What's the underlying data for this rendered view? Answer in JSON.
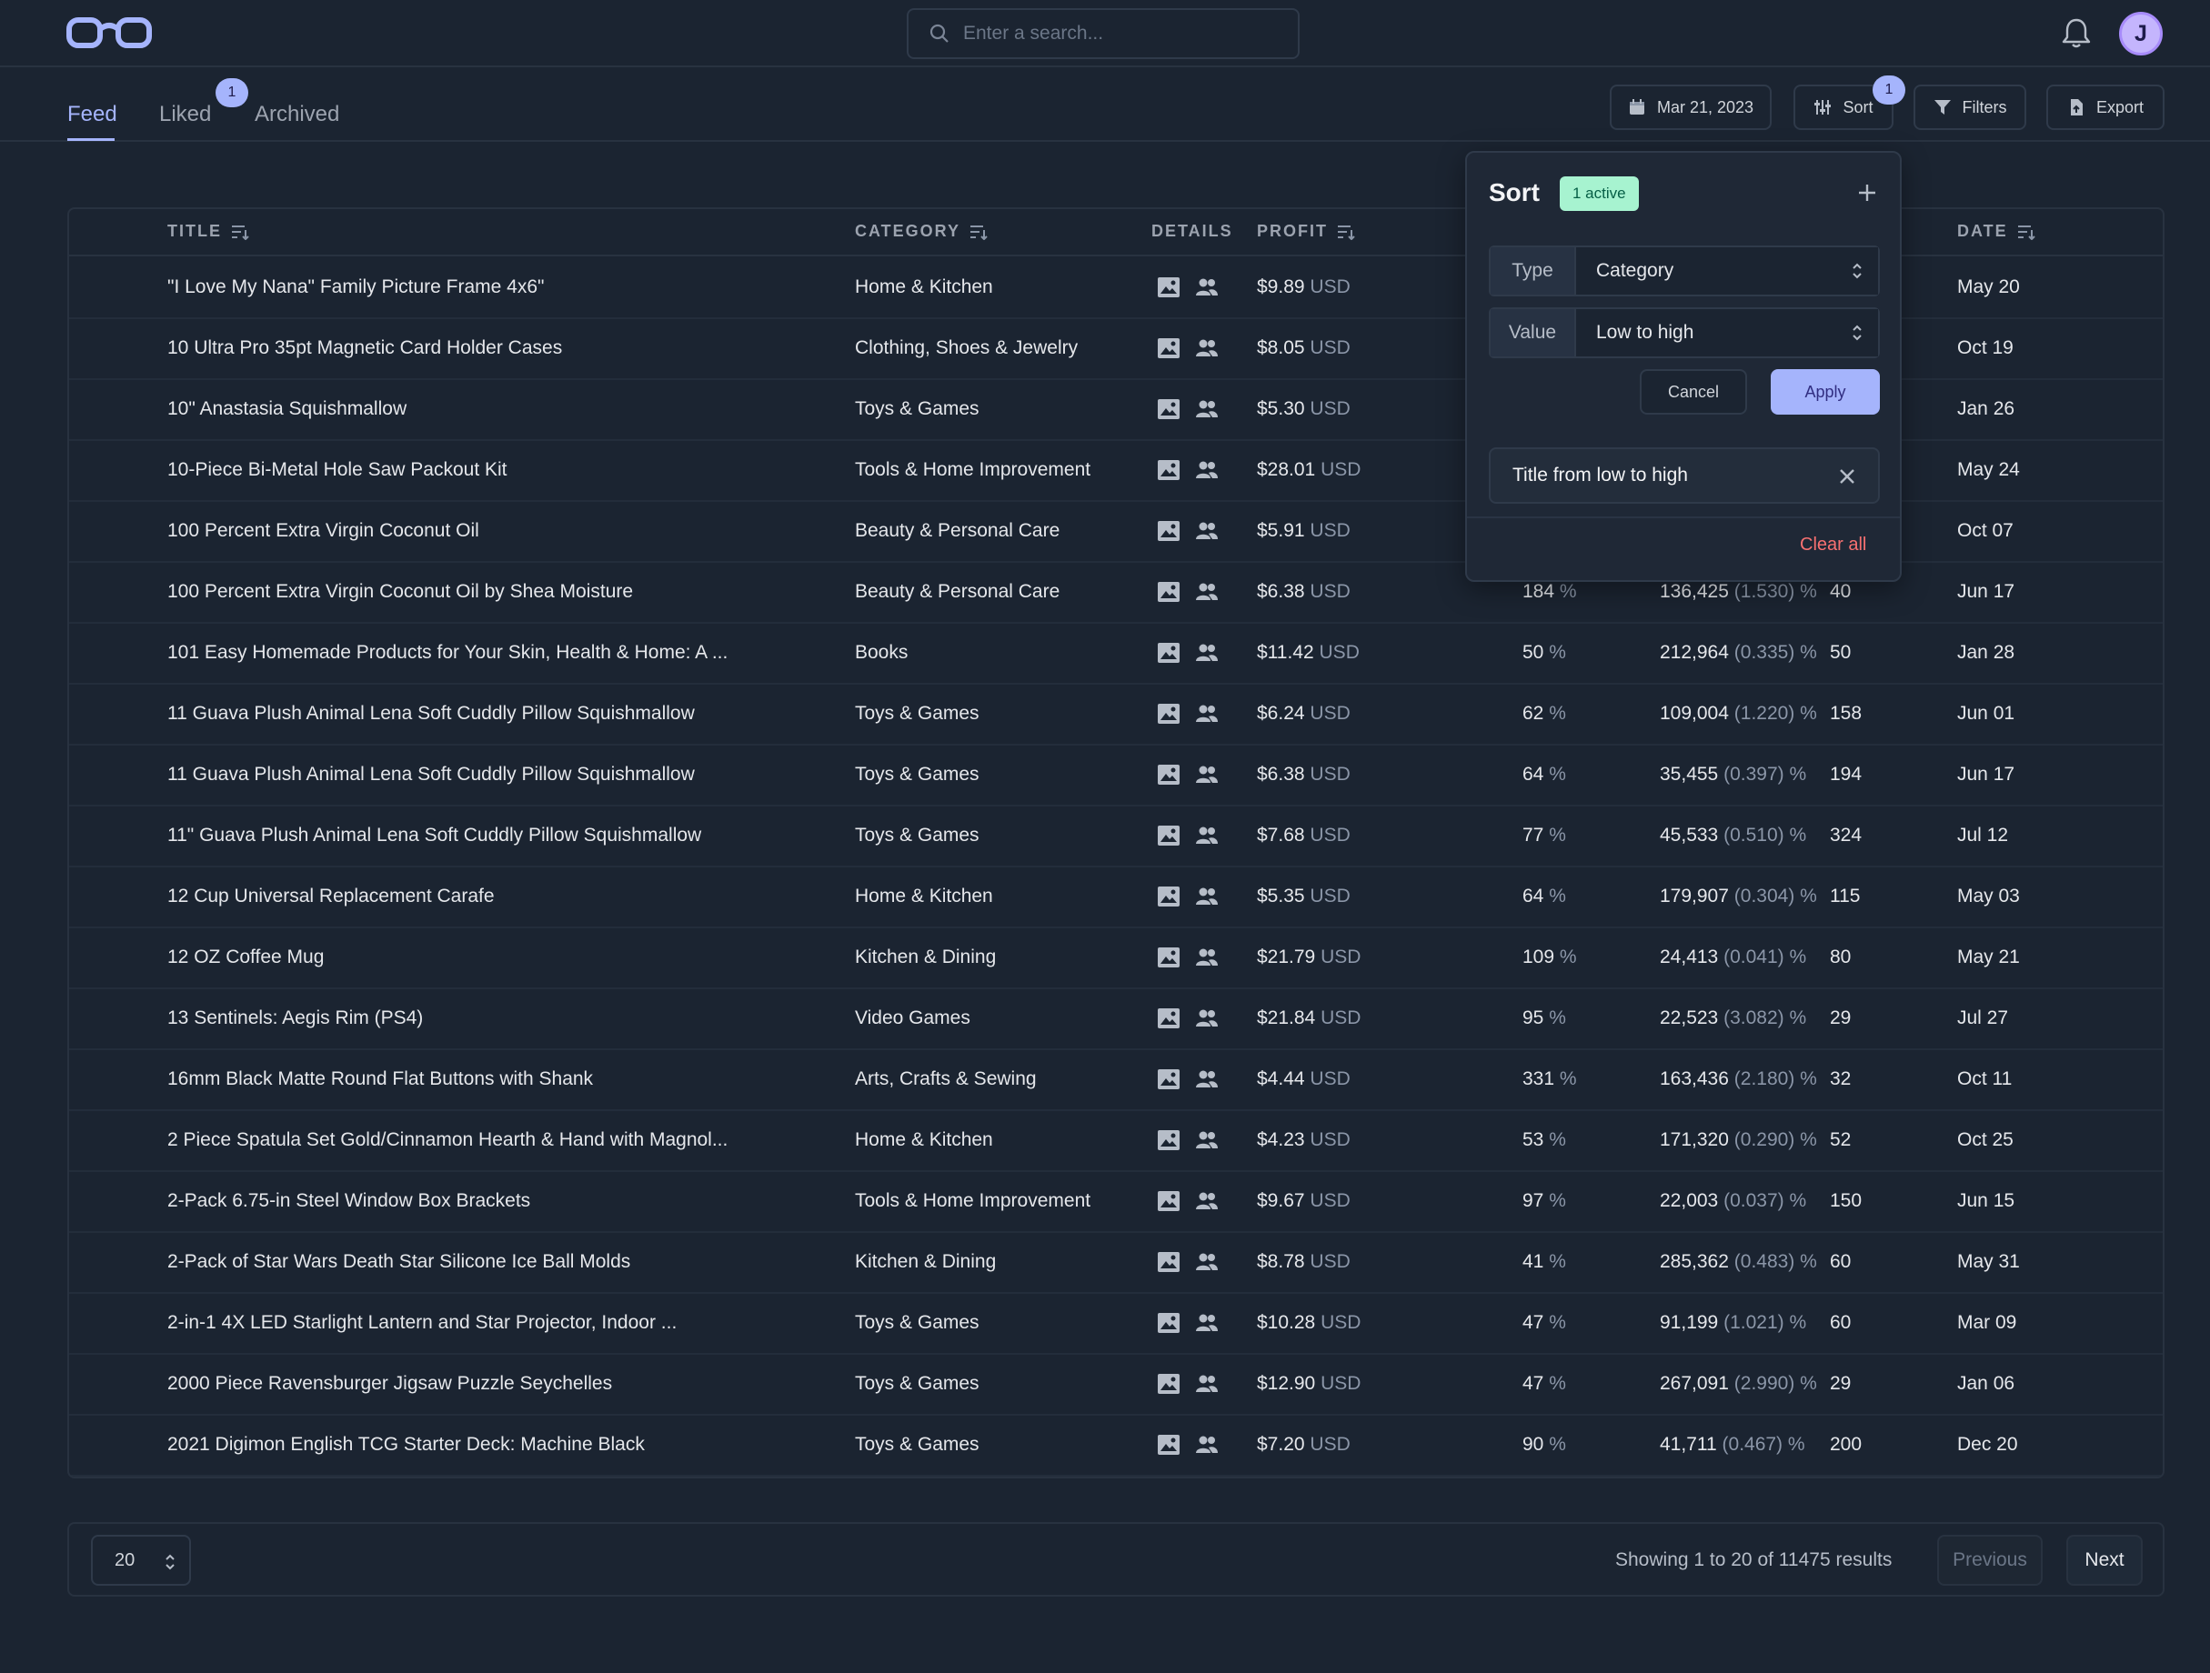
{
  "search": {
    "placeholder": "Enter a search..."
  },
  "user": {
    "initial": "J"
  },
  "tabs": [
    {
      "label": "Feed",
      "active": true
    },
    {
      "label": "Liked",
      "badge": "1"
    },
    {
      "label": "Archived"
    }
  ],
  "toolbar": {
    "date_label": "Mar 21, 2023",
    "sort_label": "Sort",
    "sort_badge": "1",
    "filters_label": "Filters",
    "export_label": "Export"
  },
  "table": {
    "headers": {
      "title": "TITLE",
      "category": "CATEGORY",
      "details": "DETAILS",
      "profit": "PROFIT",
      "date": "DATE"
    },
    "rows": [
      {
        "title": "\"I Love My Nana\" Family Picture Frame 4x6\"",
        "category": "Home & Kitchen",
        "profit": "$9.89",
        "currency": "USD",
        "margin": "",
        "sales": "",
        "sales_pct": "",
        "count": "",
        "date": "May 20"
      },
      {
        "title": "10 Ultra Pro 35pt Magnetic Card Holder Cases",
        "category": "Clothing, Shoes & Jewelry",
        "profit": "$8.05",
        "currency": "USD",
        "margin": "",
        "sales": "",
        "sales_pct": "",
        "count": "",
        "date": "Oct 19"
      },
      {
        "title": "10\" Anastasia Squishmallow",
        "category": "Toys & Games",
        "profit": "$5.30",
        "currency": "USD",
        "margin": "",
        "sales": "",
        "sales_pct": "",
        "count": "",
        "date": "Jan 26"
      },
      {
        "title": "10-Piece Bi-Metal Hole Saw Packout Kit",
        "category": "Tools & Home Improvement",
        "profit": "$28.01",
        "currency": "USD",
        "margin": "",
        "sales": "",
        "sales_pct": "",
        "count": "",
        "date": "May 24"
      },
      {
        "title": "100 Percent Extra Virgin Coconut Oil",
        "category": "Beauty & Personal Care",
        "profit": "$5.91",
        "currency": "USD",
        "margin": "",
        "sales": "",
        "sales_pct": "",
        "count": "",
        "date": "Oct 07"
      },
      {
        "title": "100 Percent Extra Virgin Coconut Oil by Shea Moisture",
        "category": "Beauty & Personal Care",
        "profit": "$6.38",
        "currency": "USD",
        "margin": "184",
        "sales": "136,425",
        "sales_pct": "(1.530)",
        "count": "40",
        "date": "Jun 17"
      },
      {
        "title": "101 Easy Homemade Products for Your Skin, Health & Home: A ...",
        "category": "Books",
        "profit": "$11.42",
        "currency": "USD",
        "margin": "50",
        "sales": "212,964",
        "sales_pct": "(0.335)",
        "count": "50",
        "date": "Jan 28"
      },
      {
        "title": "11 Guava Plush Animal Lena Soft Cuddly Pillow Squishmallow",
        "category": "Toys & Games",
        "profit": "$6.24",
        "currency": "USD",
        "margin": "62",
        "sales": "109,004",
        "sales_pct": "(1.220)",
        "count": "158",
        "date": "Jun 01"
      },
      {
        "title": "11 Guava Plush Animal Lena Soft Cuddly Pillow Squishmallow",
        "category": "Toys & Games",
        "profit": "$6.38",
        "currency": "USD",
        "margin": "64",
        "sales": "35,455",
        "sales_pct": "(0.397)",
        "count": "194",
        "date": "Jun 17"
      },
      {
        "title": "11\" Guava Plush Animal Lena Soft Cuddly Pillow Squishmallow",
        "category": "Toys & Games",
        "profit": "$7.68",
        "currency": "USD",
        "margin": "77",
        "sales": "45,533",
        "sales_pct": "(0.510)",
        "count": "324",
        "date": "Jul 12"
      },
      {
        "title": "12 Cup Universal Replacement Carafe",
        "category": "Home & Kitchen",
        "profit": "$5.35",
        "currency": "USD",
        "margin": "64",
        "sales": "179,907",
        "sales_pct": "(0.304)",
        "count": "115",
        "date": "May 03"
      },
      {
        "title": "12 OZ Coffee Mug",
        "category": "Kitchen & Dining",
        "profit": "$21.79",
        "currency": "USD",
        "margin": "109",
        "sales": "24,413",
        "sales_pct": "(0.041)",
        "count": "80",
        "date": "May 21"
      },
      {
        "title": "13 Sentinels: Aegis Rim (PS4)",
        "category": "Video Games",
        "profit": "$21.84",
        "currency": "USD",
        "margin": "95",
        "sales": "22,523",
        "sales_pct": "(3.082)",
        "count": "29",
        "date": "Jul 27"
      },
      {
        "title": "16mm Black Matte Round Flat Buttons with Shank",
        "category": "Arts, Crafts & Sewing",
        "profit": "$4.44",
        "currency": "USD",
        "margin": "331",
        "sales": "163,436",
        "sales_pct": "(2.180)",
        "count": "32",
        "date": "Oct 11"
      },
      {
        "title": "2 Piece Spatula Set Gold/Cinnamon Hearth & Hand with Magnol...",
        "category": "Home & Kitchen",
        "profit": "$4.23",
        "currency": "USD",
        "margin": "53",
        "sales": "171,320",
        "sales_pct": "(0.290)",
        "count": "52",
        "date": "Oct 25"
      },
      {
        "title": "2-Pack 6.75-in Steel Window Box Brackets",
        "category": "Tools & Home Improvement",
        "profit": "$9.67",
        "currency": "USD",
        "margin": "97",
        "sales": "22,003",
        "sales_pct": "(0.037)",
        "count": "150",
        "date": "Jun 15"
      },
      {
        "title": "2-Pack of Star Wars Death Star Silicone Ice Ball Molds",
        "category": "Kitchen & Dining",
        "profit": "$8.78",
        "currency": "USD",
        "margin": "41",
        "sales": "285,362",
        "sales_pct": "(0.483)",
        "count": "60",
        "date": "May 31"
      },
      {
        "title": "2-in-1 4X LED Starlight Lantern and Star Projector, Indoor ...",
        "category": "Toys & Games",
        "profit": "$10.28",
        "currency": "USD",
        "margin": "47",
        "sales": "91,199",
        "sales_pct": "(1.021)",
        "count": "60",
        "date": "Mar 09"
      },
      {
        "title": "2000 Piece Ravensburger Jigsaw Puzzle Seychelles",
        "category": "Toys & Games",
        "profit": "$12.90",
        "currency": "USD",
        "margin": "47",
        "sales": "267,091",
        "sales_pct": "(2.990)",
        "count": "29",
        "date": "Jan 06"
      },
      {
        "title": "2021 Digimon English TCG Starter Deck: Machine Black",
        "category": "Toys & Games",
        "profit": "$7.20",
        "currency": "USD",
        "margin": "90",
        "sales": "41,711",
        "sales_pct": "(0.467)",
        "count": "200",
        "date": "Dec 20"
      }
    ]
  },
  "pagination": {
    "page_size": "20",
    "showing": "Showing 1 to 20 of 11475 results",
    "previous": "Previous",
    "next": "Next"
  },
  "sort_panel": {
    "title": "Sort",
    "active_badge": "1 active",
    "type_label": "Type",
    "type_value": "Category",
    "value_label": "Value",
    "value_value": "Low to high",
    "cancel": "Cancel",
    "apply": "Apply",
    "chip": "Title from low to high",
    "clear_all": "Clear all"
  },
  "colors": {
    "accent": "#a5b4fc",
    "background": "#1b2431",
    "danger": "#f87171",
    "success_bg": "#a7f3d0"
  }
}
